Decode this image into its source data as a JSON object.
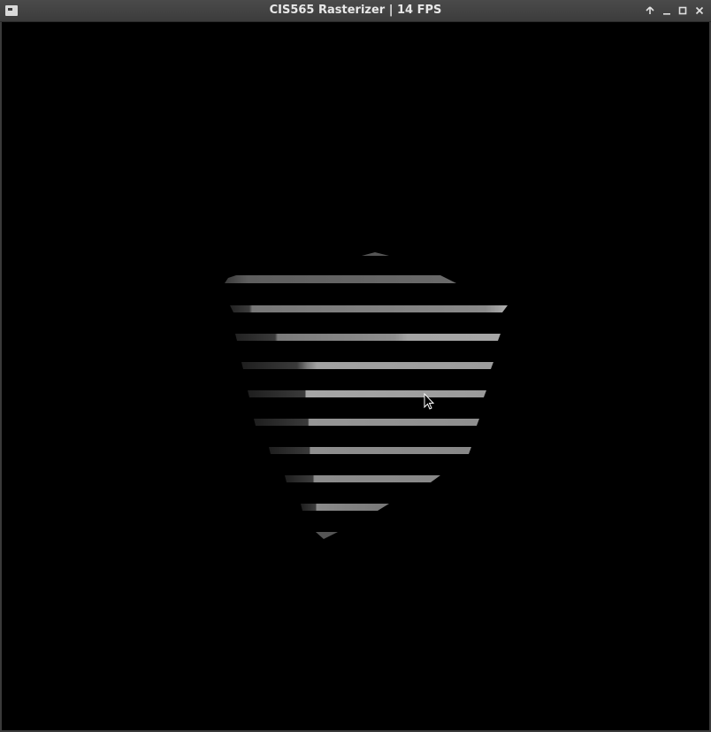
{
  "window": {
    "title": "CIS565 Rasterizer | 14 FPS"
  },
  "titlebar": {
    "menu_icon": "window-menu-icon",
    "buttons": [
      "keep-above-icon",
      "minimize-icon",
      "maximize-icon",
      "close-icon"
    ]
  },
  "viewport": {
    "background": "#000000",
    "stripe_colors": [
      "#2b2b2b",
      "#5a5a5a",
      "#8c8c8c",
      "#a6a6a6"
    ]
  }
}
